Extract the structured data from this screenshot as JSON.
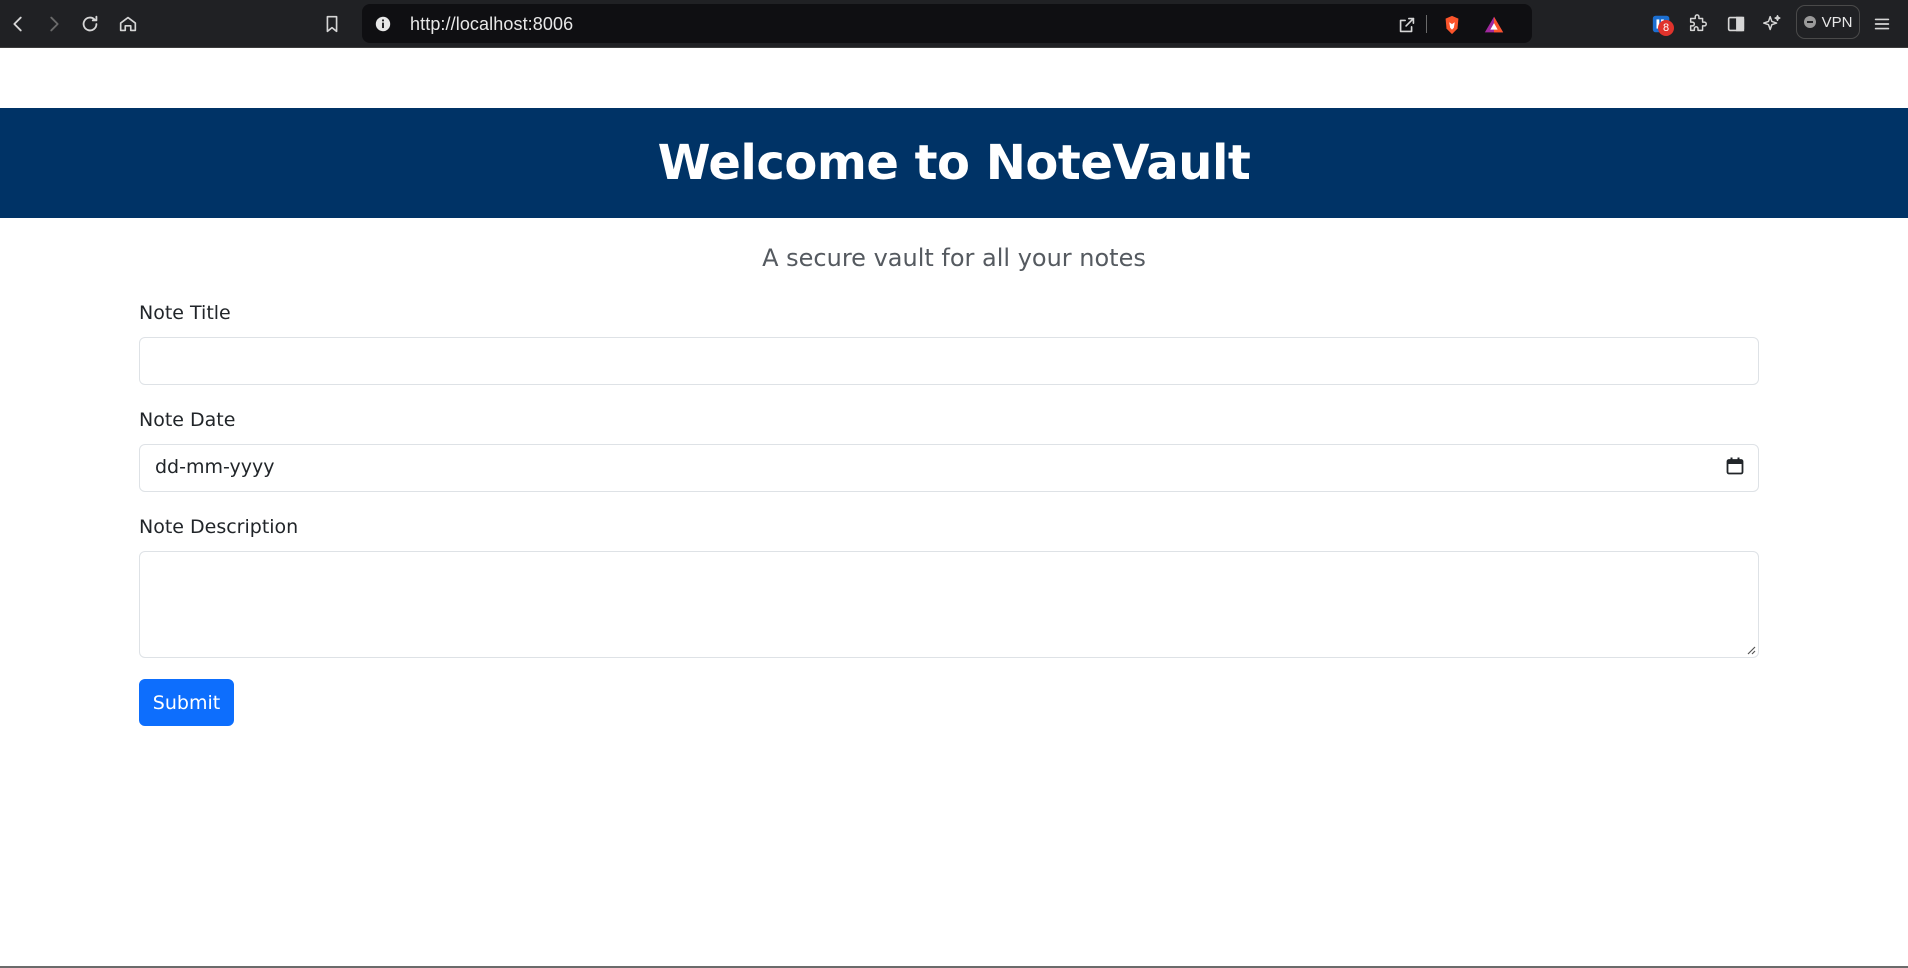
{
  "browser": {
    "url": "http://localhost:8006",
    "extension_badge_count": "8",
    "vpn_label": "VPN"
  },
  "header": {
    "title": "Welcome to NoteVault",
    "background_color": "#003366"
  },
  "tagline": "A secure vault for all your notes",
  "form": {
    "title_label": "Note Title",
    "title_value": "",
    "date_label": "Note Date",
    "date_placeholder": "dd-mm-yyyy",
    "description_label": "Note Description",
    "description_value": "",
    "submit_label": "Submit",
    "submit_color": "#0d6efd"
  },
  "icons": {
    "back": "back-arrow-icon",
    "forward": "forward-arrow-icon",
    "reload": "reload-icon",
    "home": "home-icon",
    "bookmark": "bookmark-icon",
    "info": "info-icon",
    "share": "share-icon",
    "brave": "brave-shield-icon",
    "rewards": "brave-rewards-icon",
    "extension": "extension-icon",
    "puzzle": "puzzle-icon",
    "sidebar": "sidebar-icon",
    "leo": "leo-ai-icon",
    "menu": "hamburger-menu-icon",
    "calendar": "calendar-icon"
  }
}
